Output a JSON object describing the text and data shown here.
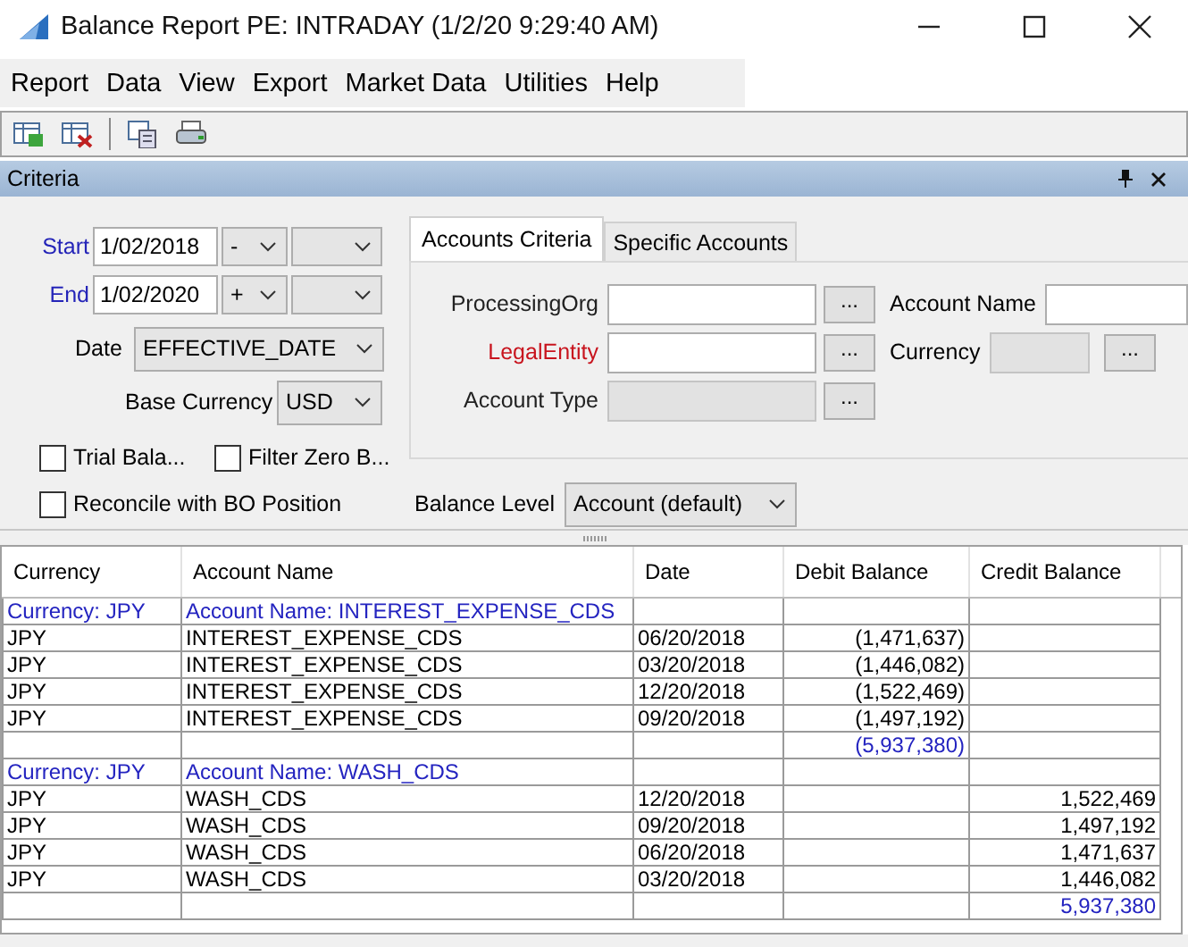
{
  "window": {
    "title": "Balance Report PE: INTRADAY (1/2/20 9:29:40 AM)"
  },
  "menu": [
    "Report",
    "Data",
    "View",
    "Export",
    "Market Data",
    "Utilities",
    "Help"
  ],
  "panel": {
    "title": "Criteria"
  },
  "criteria": {
    "start": {
      "label": "Start",
      "value": "1/02/2018",
      "sign": "-"
    },
    "end": {
      "label": "End",
      "value": "1/02/2020",
      "sign": "+"
    },
    "date": {
      "label": "Date",
      "value": "EFFECTIVE_DATE"
    },
    "base_currency": {
      "label": "Base Currency",
      "value": "USD"
    },
    "checkboxes": [
      {
        "label": "Trial Bala...",
        "checked": false
      },
      {
        "label": "Filter Zero B...",
        "checked": false
      },
      {
        "label": "Reconcile with BO Position",
        "checked": false
      }
    ],
    "balance_level": {
      "label": "Balance Level",
      "value": "Account (default)"
    }
  },
  "tabs": [
    {
      "label": "Accounts Criteria",
      "selected": true
    },
    {
      "label": "Specific Accounts",
      "selected": false
    }
  ],
  "account_fields": [
    {
      "label": "ProcessingOrg",
      "required": false,
      "disabled": false,
      "button": "..."
    },
    {
      "label": "LegalEntity",
      "required": true,
      "disabled": false,
      "button": "..."
    },
    {
      "label": "Account Type",
      "required": false,
      "disabled": true,
      "button": "..."
    }
  ],
  "side_fields": [
    {
      "label": "Account Name",
      "disabled": false
    },
    {
      "label": "Currency",
      "disabled": true,
      "button": "..."
    }
  ],
  "table": {
    "columns": [
      "Currency",
      "Account Name",
      "Date",
      "Debit Balance",
      "Credit Balance"
    ],
    "rows": [
      {
        "kind": "group",
        "cells": [
          "Currency: JPY",
          "Account Name: INTEREST_EXPENSE_CDS",
          "",
          "",
          ""
        ]
      },
      {
        "kind": "data",
        "cells": [
          "JPY",
          "INTEREST_EXPENSE_CDS",
          "06/20/2018",
          "(1,471,637)",
          ""
        ]
      },
      {
        "kind": "data",
        "cells": [
          "JPY",
          "INTEREST_EXPENSE_CDS",
          "03/20/2018",
          "(1,446,082)",
          ""
        ]
      },
      {
        "kind": "data",
        "cells": [
          "JPY",
          "INTEREST_EXPENSE_CDS",
          "12/20/2018",
          "(1,522,469)",
          ""
        ]
      },
      {
        "kind": "data",
        "cells": [
          "JPY",
          "INTEREST_EXPENSE_CDS",
          "09/20/2018",
          "(1,497,192)",
          ""
        ]
      },
      {
        "kind": "total",
        "cells": [
          "",
          "",
          "",
          "(5,937,380)",
          ""
        ]
      },
      {
        "kind": "group",
        "cells": [
          "Currency: JPY",
          "Account Name: WASH_CDS",
          "",
          "",
          ""
        ]
      },
      {
        "kind": "data",
        "cells": [
          "JPY",
          "WASH_CDS",
          "12/20/2018",
          "",
          "1,522,469"
        ]
      },
      {
        "kind": "data",
        "cells": [
          "JPY",
          "WASH_CDS",
          "09/20/2018",
          "",
          "1,497,192"
        ]
      },
      {
        "kind": "data",
        "cells": [
          "JPY",
          "WASH_CDS",
          "06/20/2018",
          "",
          "1,471,637"
        ]
      },
      {
        "kind": "data",
        "cells": [
          "JPY",
          "WASH_CDS",
          "03/20/2018",
          "",
          "1,446,082"
        ]
      },
      {
        "kind": "total",
        "cells": [
          "",
          "",
          "",
          "",
          "5,937,380"
        ]
      }
    ]
  }
}
